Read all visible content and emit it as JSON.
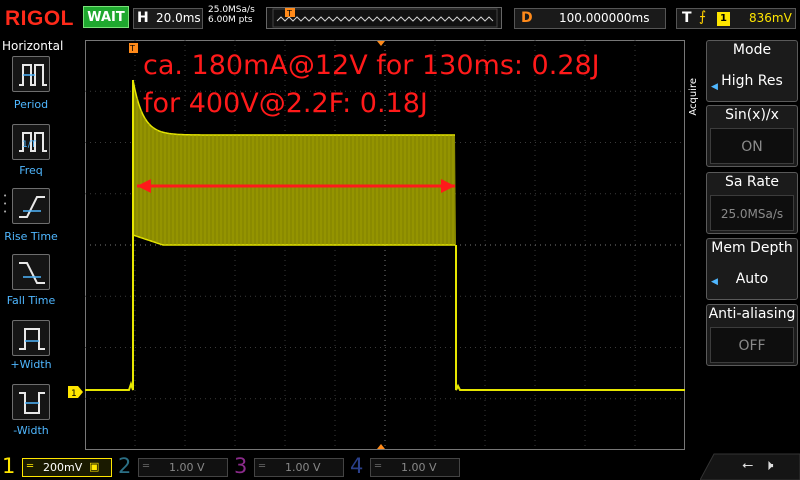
{
  "top_bar": {
    "logo": "RIGOL",
    "run_state": "WAIT",
    "timebase_label": "H",
    "timebase": "20.0ms",
    "sample_rate": "25.0MSa/s",
    "memory_depth": "6.00M pts",
    "delay_label": "D",
    "delay": "100.000000ms",
    "trigger_label": "T",
    "trigger_source": "1",
    "trigger_level": "836mV"
  },
  "left_menu": {
    "title": "Horizontal",
    "items": [
      {
        "label": "Period",
        "icon": "period-icon"
      },
      {
        "label": "Freq",
        "icon": "frequency-icon"
      },
      {
        "label": "Rise Time",
        "icon": "rise-time-icon"
      },
      {
        "label": "Fall Time",
        "icon": "fall-time-icon"
      },
      {
        "label": "+Width",
        "icon": "positive-width-icon"
      },
      {
        "label": "-Width",
        "icon": "negative-width-icon"
      }
    ]
  },
  "annotation": {
    "line1": "ca. 180mA@12V for 130ms: 0.28J",
    "line2": "for 400V@2.2F: 0.18J",
    "color": "#ff1a1a"
  },
  "waveform": {
    "channel_marker": "1",
    "trigger_marker": "T",
    "color": "#e6e600",
    "fill_color": "#8a8a00"
  },
  "right_menu": {
    "side_title": "Acquire",
    "items": [
      {
        "title": "Mode",
        "value": "High Res"
      },
      {
        "title": "Sin(x)/x",
        "value": "ON"
      },
      {
        "title": "Sa Rate",
        "value": "25.0MSa/s"
      },
      {
        "title": "Mem Depth",
        "value": "Auto"
      },
      {
        "title": "Anti-aliasing",
        "value": "OFF"
      }
    ]
  },
  "channels": [
    {
      "num": "1",
      "scale": "200mV",
      "color": "#ffe600"
    },
    {
      "num": "2",
      "scale": "1.00 V",
      "color": "#37c7ff"
    },
    {
      "num": "3",
      "scale": "1.00 V",
      "color": "#ff40ff"
    },
    {
      "num": "4",
      "scale": "1.00 V",
      "color": "#3c6bff"
    }
  ]
}
